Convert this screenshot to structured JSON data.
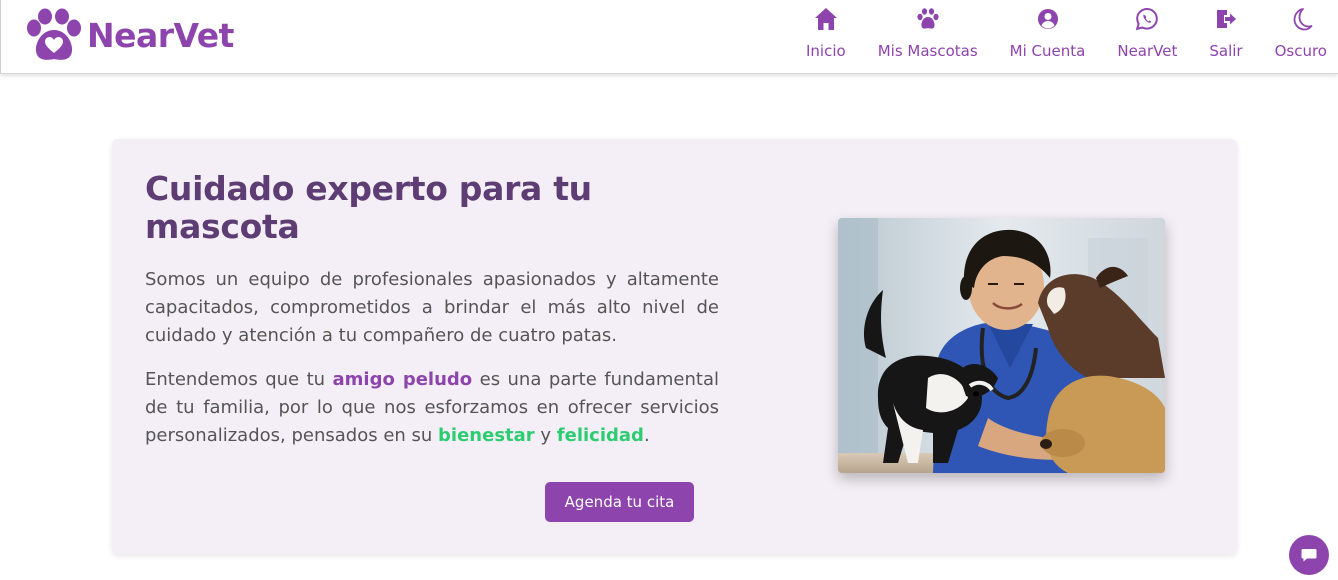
{
  "brand": {
    "name": "NearVet",
    "logo_icon": "paw-heart-icon",
    "color": "#8e44ad"
  },
  "nav": {
    "items": [
      {
        "label": "Inicio",
        "icon": "home-icon"
      },
      {
        "label": "Mis Mascotas",
        "icon": "paw-icon"
      },
      {
        "label": "Mi Cuenta",
        "icon": "user-circle-icon"
      },
      {
        "label": "NearVet",
        "icon": "whatsapp-icon"
      },
      {
        "label": "Salir",
        "icon": "logout-icon"
      },
      {
        "label": "Oscuro",
        "icon": "moon-icon"
      }
    ]
  },
  "hero": {
    "title": "Cuidado experto para tu mascota",
    "paragraph1": "Somos un equipo de profesionales apasionados y altamente capacitados, comprometidos a brindar el más alto nivel de cuidado y atención a tu compañero de cuatro patas.",
    "paragraph2": {
      "part1": "Entendemos que tu ",
      "highlight1": "amigo peludo",
      "part2": " es una parte fundamental de tu familia, por lo que nos esforzamos en ofrecer servicios personalizados, pensados en su ",
      "highlight2": "bienestar",
      "part3": " y ",
      "highlight3": "felicidad",
      "part4": "."
    },
    "cta_label": "Agenda tu cita",
    "image_description": "veterinarian-with-puppies-photo"
  },
  "chat": {
    "icon": "chat-bubble-icon"
  },
  "colors": {
    "accent": "#8e44ad",
    "title": "#5e3d74",
    "highlight_green": "#2ecc71",
    "hero_bg": "#f4eff6"
  }
}
